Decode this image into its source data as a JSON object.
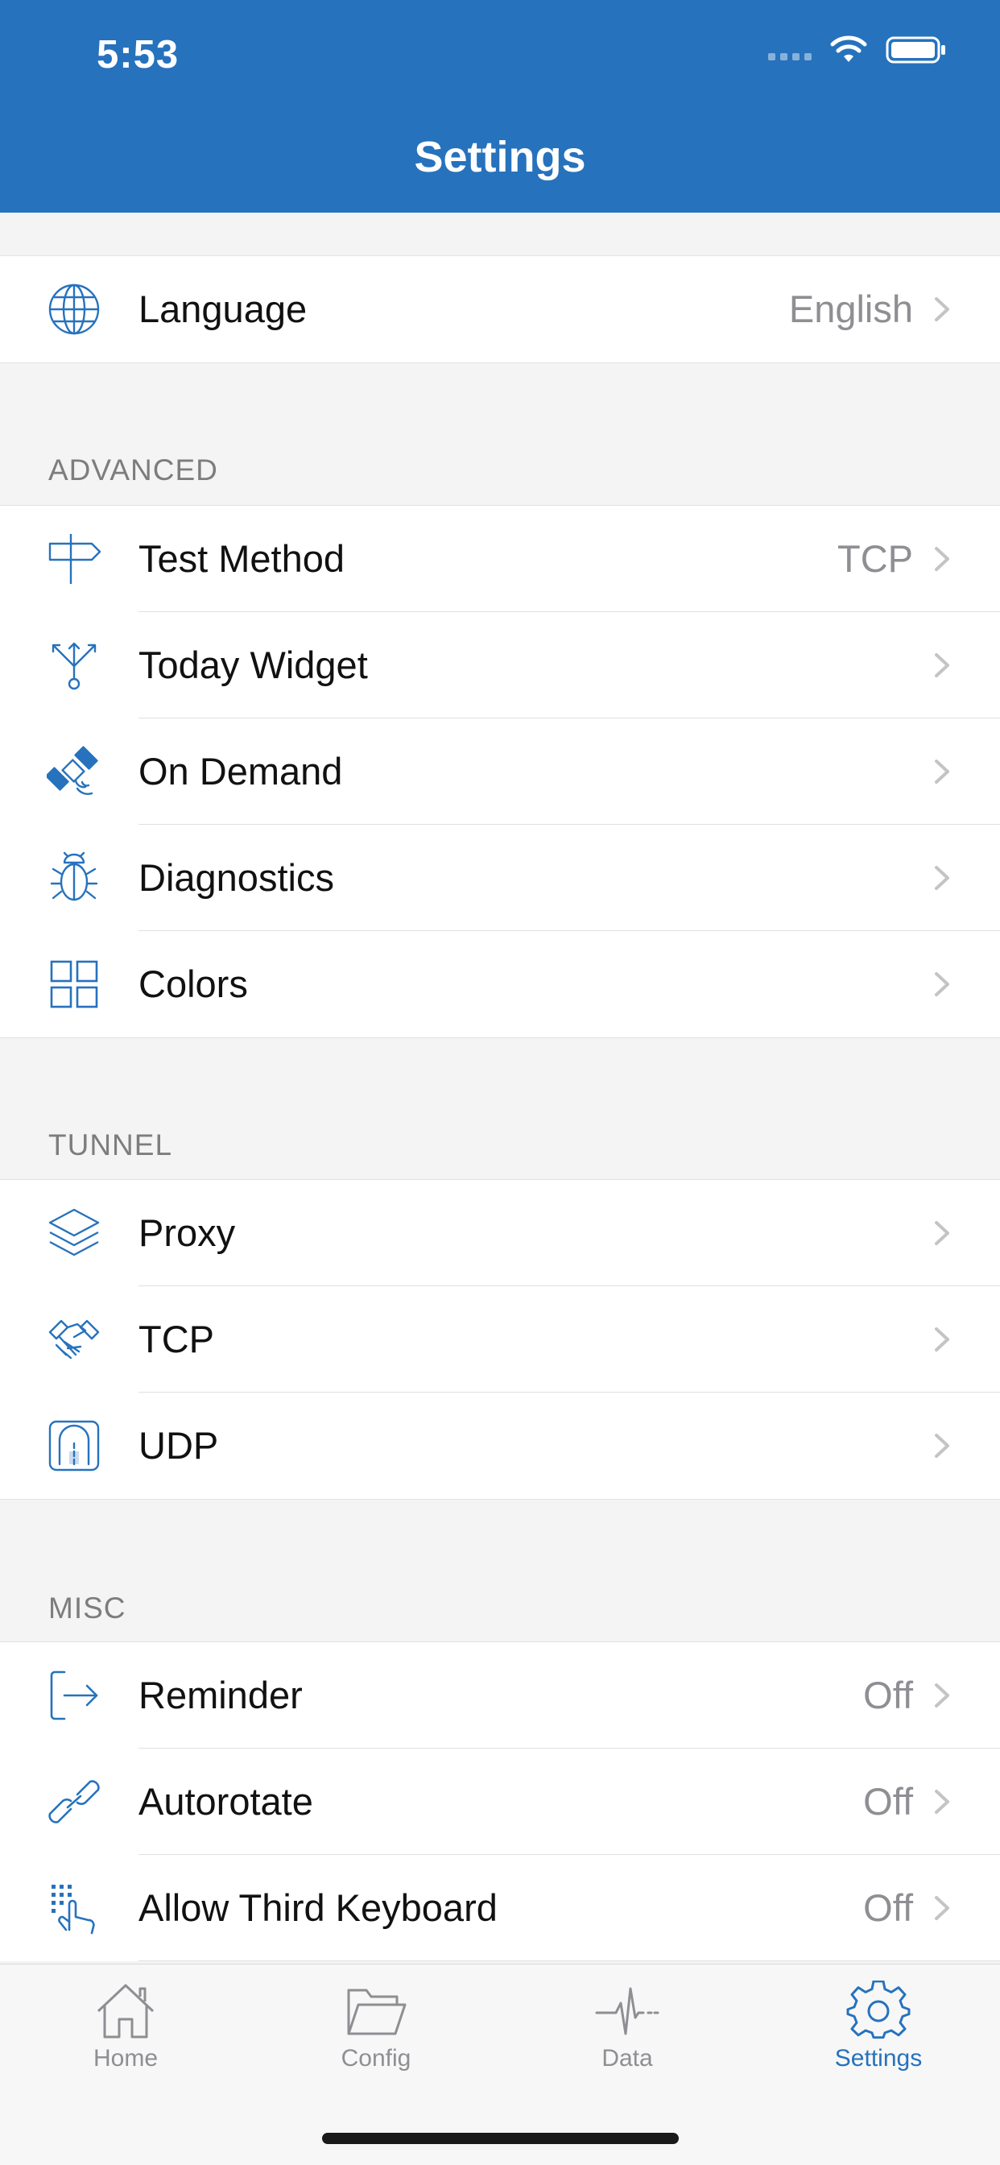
{
  "status_bar": {
    "time": "5:53"
  },
  "nav": {
    "title": "Settings"
  },
  "colors": {
    "accent": "#2672bd",
    "secondary_text": "#8e8e93"
  },
  "general": {
    "items": [
      {
        "icon": "globe-icon",
        "label": "Language",
        "value": "English"
      }
    ]
  },
  "advanced": {
    "header": "ADVANCED",
    "items": [
      {
        "icon": "signpost-icon",
        "label": "Test Method",
        "value": "TCP"
      },
      {
        "icon": "fork-arrows-icon",
        "label": "Today Widget",
        "value": ""
      },
      {
        "icon": "satellite-icon",
        "label": "On Demand",
        "value": ""
      },
      {
        "icon": "bug-icon",
        "label": "Diagnostics",
        "value": ""
      },
      {
        "icon": "grid-icon",
        "label": "Colors",
        "value": ""
      }
    ]
  },
  "tunnel": {
    "header": "TUNNEL",
    "items": [
      {
        "icon": "layers-icon",
        "label": "Proxy",
        "value": ""
      },
      {
        "icon": "handshake-icon",
        "label": "TCP",
        "value": ""
      },
      {
        "icon": "tunnel-icon",
        "label": "UDP",
        "value": ""
      }
    ]
  },
  "misc": {
    "header": "MISC",
    "items": [
      {
        "icon": "exit-arrow-icon",
        "label": "Reminder",
        "value": "Off"
      },
      {
        "icon": "link-icon",
        "label": "Autorotate",
        "value": "Off"
      },
      {
        "icon": "keypad-touch-icon",
        "label": "Allow Third Keyboard",
        "value": "Off"
      }
    ]
  },
  "tabbar": {
    "tabs": [
      {
        "icon": "home-icon",
        "label": "Home",
        "active": false
      },
      {
        "icon": "folder-icon",
        "label": "Config",
        "active": false
      },
      {
        "icon": "pulse-icon",
        "label": "Data",
        "active": false
      },
      {
        "icon": "gear-icon",
        "label": "Settings",
        "active": true
      }
    ]
  }
}
